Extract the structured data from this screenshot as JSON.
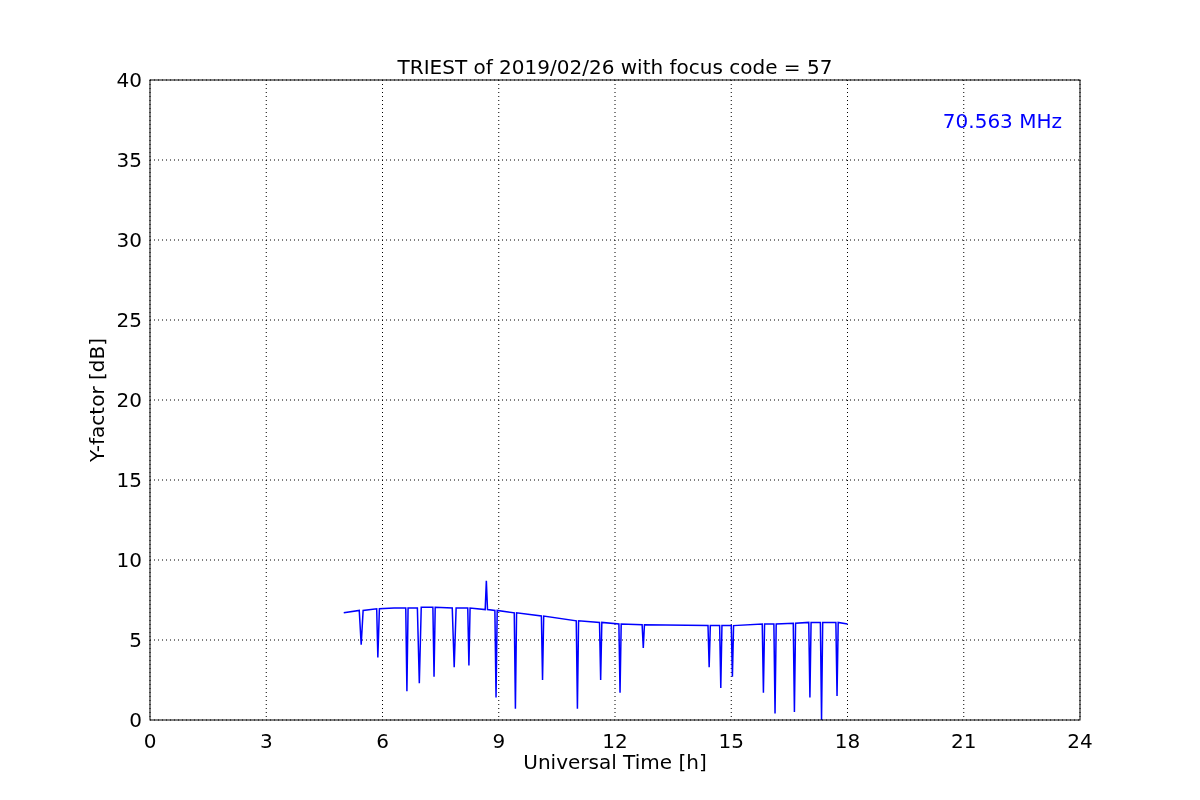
{
  "figure": {
    "chart_data": {
      "type": "line",
      "title": "TRIEST of 2019/02/26 with focus code = 57",
      "xlabel": "Universal Time [h]",
      "ylabel": "Y-factor [dB]",
      "x": [
        5.0,
        5.4,
        5.45,
        5.5,
        5.85,
        5.88,
        5.92,
        6.3,
        6.6,
        6.63,
        6.66,
        6.9,
        6.95,
        7.0,
        7.3,
        7.33,
        7.36,
        7.8,
        7.85,
        7.9,
        8.2,
        8.23,
        8.26,
        8.65,
        8.68,
        8.71,
        8.9,
        8.93,
        8.96,
        9.4,
        9.43,
        9.46,
        10.1,
        10.13,
        10.16,
        11.0,
        11.03,
        11.06,
        11.6,
        11.63,
        11.66,
        12.1,
        12.13,
        12.16,
        12.7,
        12.73,
        12.76,
        14.4,
        14.43,
        14.46,
        14.7,
        14.73,
        14.76,
        15.0,
        15.03,
        15.06,
        15.8,
        15.83,
        15.86,
        16.1,
        16.13,
        16.16,
        16.6,
        16.63,
        16.66,
        17.0,
        17.03,
        17.06,
        17.3,
        17.33,
        17.36,
        17.7,
        17.73,
        17.76,
        18.0
      ],
      "grid": true,
      "series": [
        {
          "color": "#0000ff",
          "values": [
            6.7,
            6.85,
            4.7,
            6.85,
            6.95,
            3.9,
            6.95,
            7.0,
            7.0,
            1.8,
            7.0,
            7.0,
            2.3,
            7.05,
            7.05,
            2.7,
            7.05,
            7.0,
            3.3,
            7.0,
            7.0,
            3.4,
            7.0,
            6.9,
            8.7,
            6.9,
            6.85,
            1.4,
            6.85,
            6.7,
            0.7,
            6.7,
            6.5,
            2.5,
            6.5,
            6.2,
            0.7,
            6.2,
            6.1,
            2.5,
            6.1,
            6.0,
            1.7,
            6.0,
            5.95,
            4.5,
            5.95,
            5.9,
            3.3,
            5.9,
            5.9,
            2.0,
            5.9,
            5.9,
            2.7,
            5.9,
            6.0,
            1.7,
            6.0,
            6.0,
            0.4,
            6.0,
            6.05,
            0.5,
            6.05,
            6.1,
            1.4,
            6.1,
            6.1,
            0.0,
            6.1,
            6.1,
            1.5,
            6.1,
            6.0
          ]
        }
      ],
      "xlim": [
        0,
        24
      ],
      "ylim": [
        0,
        40
      ],
      "xticks": [
        0,
        3,
        6,
        9,
        12,
        15,
        18,
        21,
        24
      ],
      "yticks": [
        0,
        5,
        10,
        15,
        20,
        25,
        30,
        35,
        40
      ],
      "annotations": [
        {
          "text": "70.563 MHz"
        }
      ]
    }
  }
}
